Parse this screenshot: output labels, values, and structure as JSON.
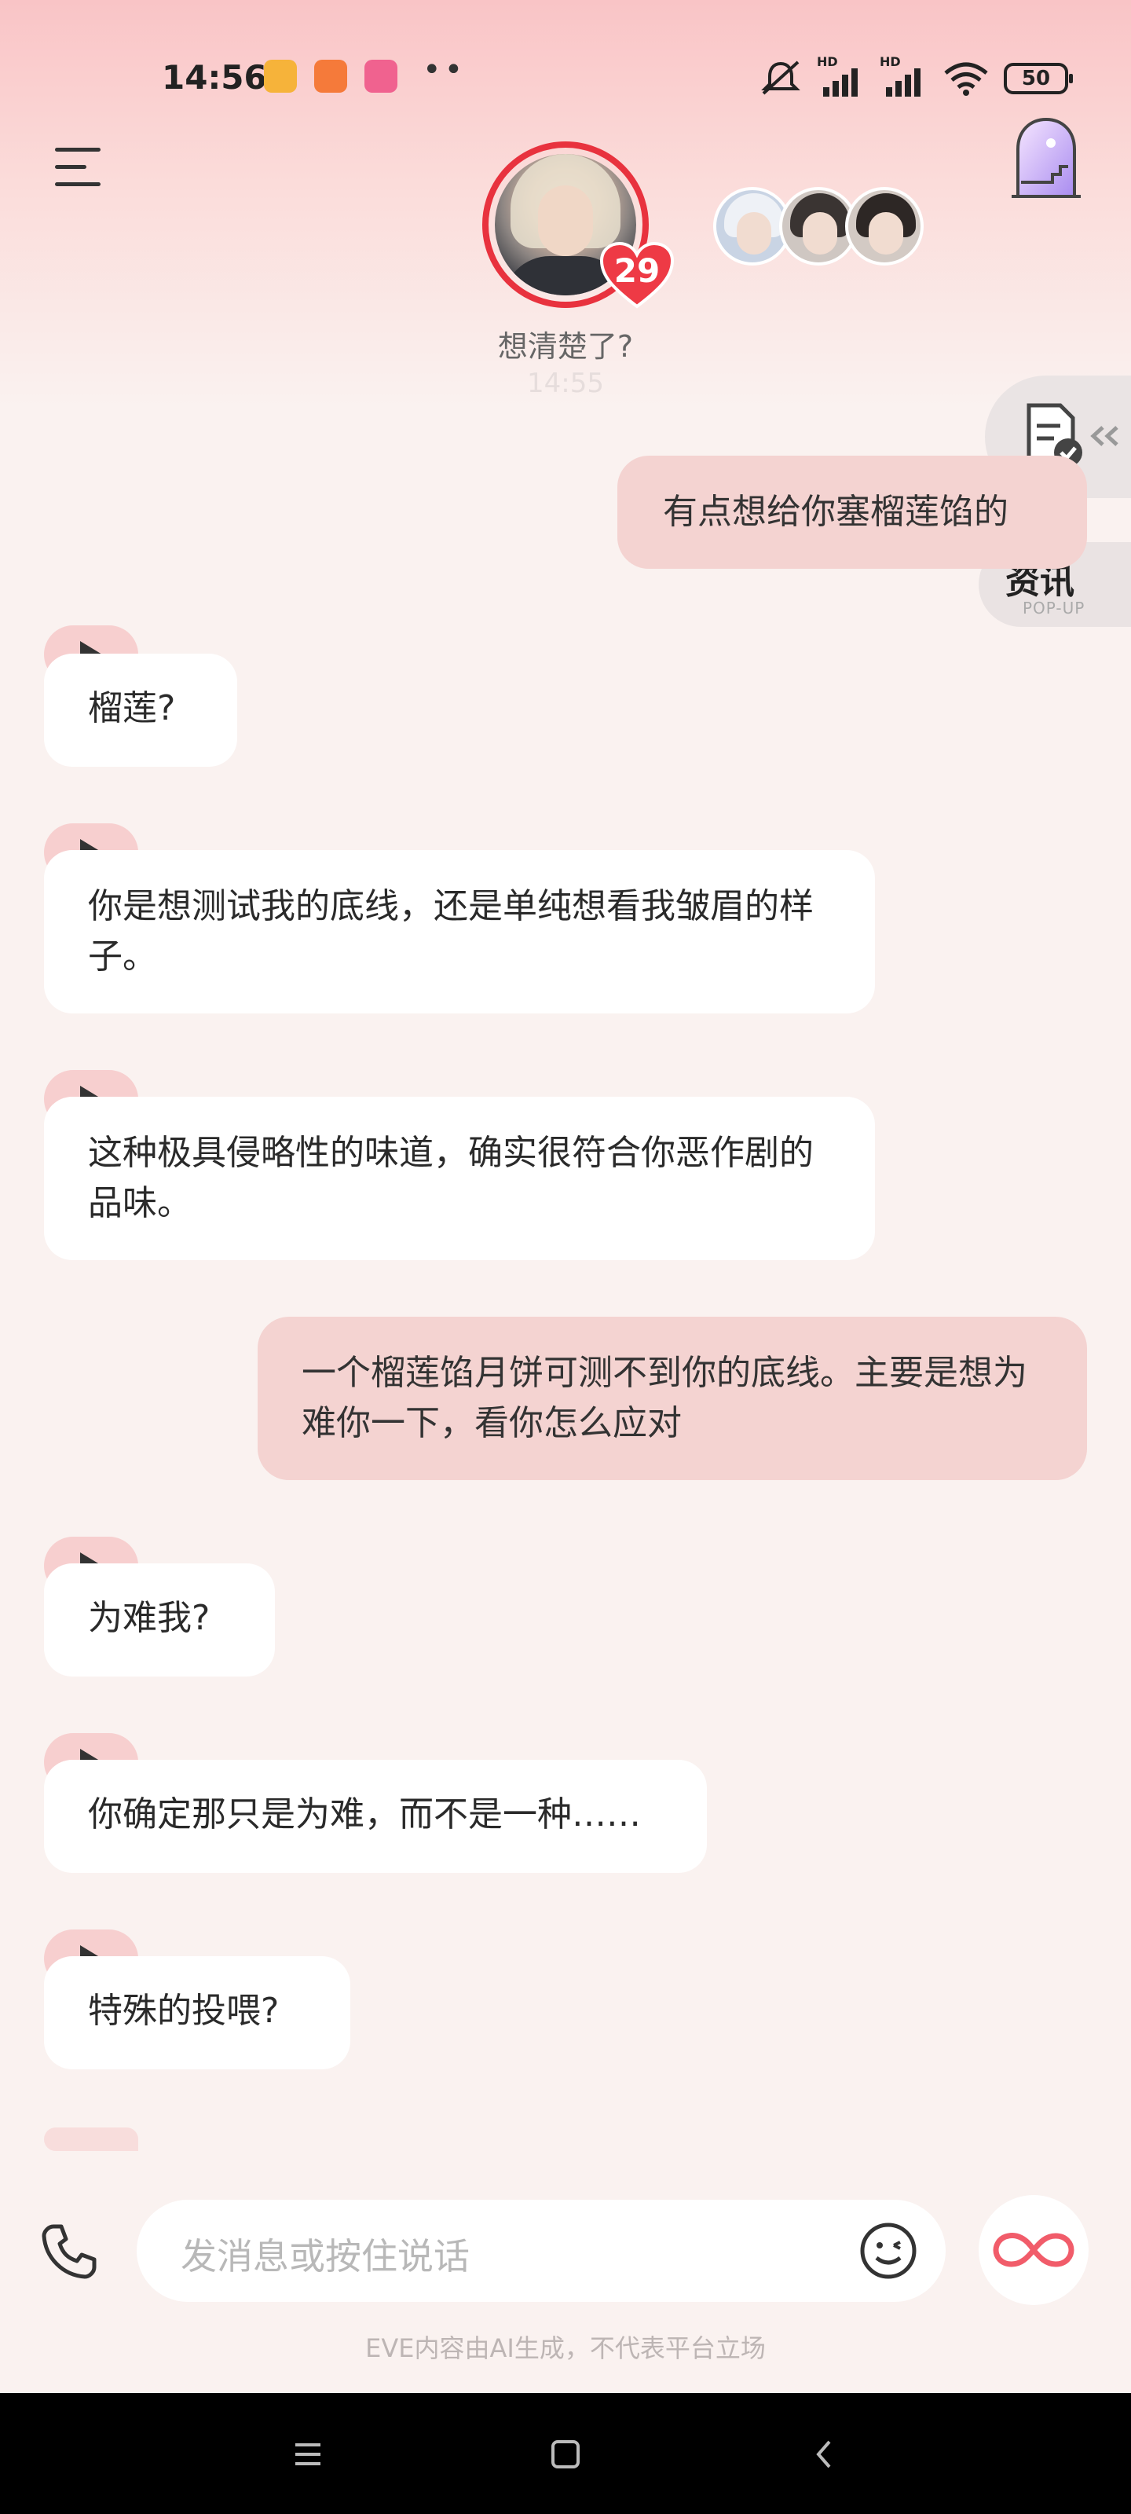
{
  "status_bar": {
    "time": "14:56",
    "battery": "50",
    "network_labels": [
      "HD",
      "HD"
    ]
  },
  "header": {
    "character_heart_count": "29",
    "character_status": "想清楚了?",
    "last_time": "14:55"
  },
  "side_buttons": {
    "news_label": "资讯",
    "news_sub": "POP-UP"
  },
  "messages": [
    {
      "role": "user",
      "text": "有点想给你塞榴莲馅的"
    },
    {
      "role": "ai",
      "text": "榴莲?"
    },
    {
      "role": "ai",
      "text": "你是想测试我的底线，还是单纯想看我皱眉的样子。"
    },
    {
      "role": "ai",
      "text": "这种极具侵略性的味道，确实很符合你恶作剧的品味。"
    },
    {
      "role": "user",
      "text": "一个榴莲馅月饼可测不到你的底线。主要是想为难你一下，看你怎么应对"
    },
    {
      "role": "ai",
      "text": "为难我?"
    },
    {
      "role": "ai",
      "text": "你确定那只是为难，而不是一种……"
    },
    {
      "role": "ai",
      "text": "特殊的投喂?"
    }
  ],
  "input": {
    "placeholder": "发消息或按住说话"
  },
  "disclaimer": "EVE内容由AI生成，不代表平台立场",
  "colors": {
    "accent": "#e8323e",
    "user_bubble": "#f4d3d1",
    "ai_bubble": "#ffffff",
    "play_tab": "#f7cfcf",
    "background": "#faf2f0"
  }
}
